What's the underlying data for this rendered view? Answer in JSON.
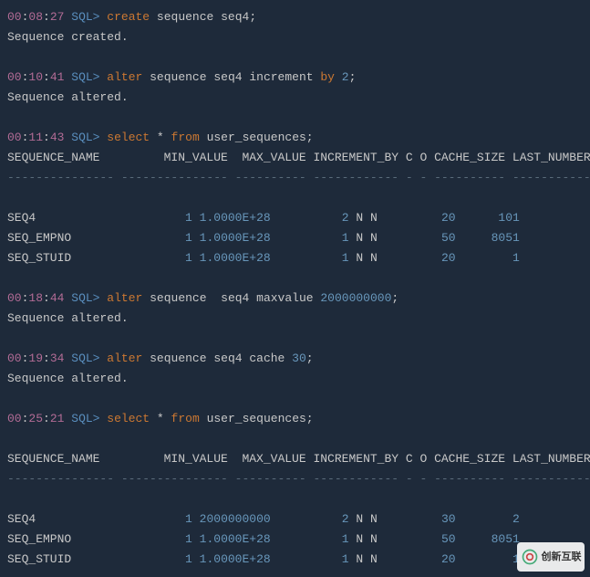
{
  "cmd1": {
    "h": "00",
    "m": "08",
    "s": "27",
    "prompt": "SQL>",
    "k1": "create",
    "id1": "sequence seq4",
    "semi": ";"
  },
  "res1": "Sequence created.",
  "cmd2": {
    "h": "00",
    "m": "10",
    "s": "41",
    "prompt": "SQL>",
    "k1": "alter",
    "id1": "sequence seq4 increment",
    "k2": "by",
    "num": "2",
    "semi": ";"
  },
  "res2": "Sequence altered.",
  "cmd3": {
    "h": "00",
    "m": "11",
    "s": "43",
    "prompt": "SQL>",
    "k1": "select",
    "star": "*",
    "k2": "from",
    "id1": "user_sequences",
    "semi": ";"
  },
  "hdr1": "SEQUENCE_NAME         MIN_VALUE  MAX_VALUE INCREMENT_BY C O CACHE_SIZE LAST_NUMBER",
  "dash1": "--------------- --------------- ---------- ------------ - - ---------- -----------",
  "row1a": {
    "name": "SEQ4           ",
    "min": "         1",
    "max": "1.0000E+28",
    "inc": "         2",
    "c": "N",
    "o": "N",
    "cache": "        20",
    "last": "     101"
  },
  "row1b": {
    "name": "SEQ_EMPNO      ",
    "min": "         1",
    "max": "1.0000E+28",
    "inc": "         1",
    "c": "N",
    "o": "N",
    "cache": "        50",
    "last": "    8051"
  },
  "row1c": {
    "name": "SEQ_STUID      ",
    "min": "         1",
    "max": "1.0000E+28",
    "inc": "         1",
    "c": "N",
    "o": "N",
    "cache": "        20",
    "last": "       1"
  },
  "cmd4": {
    "h": "00",
    "m": "18",
    "s": "44",
    "prompt": "SQL>",
    "k1": "alter",
    "id1": "sequence  seq4 maxvalue",
    "num": "2000000000",
    "semi": ";"
  },
  "res4": "Sequence altered.",
  "cmd5": {
    "h": "00",
    "m": "19",
    "s": "34",
    "prompt": "SQL>",
    "k1": "alter",
    "id1": "sequence seq4 cache",
    "num": "30",
    "semi": ";"
  },
  "res5": "Sequence altered.",
  "cmd6": {
    "h": "00",
    "m": "25",
    "s": "21",
    "prompt": "SQL>",
    "k1": "select",
    "star": "*",
    "k2": "from",
    "id1": "user_sequences",
    "semi": ";"
  },
  "hdr2": "SEQUENCE_NAME         MIN_VALUE  MAX_VALUE INCREMENT_BY C O CACHE_SIZE LAST_NUMBER",
  "dash2": "--------------- --------------- ---------- ------------ - - ---------- -----------",
  "row2a": {
    "name": "SEQ4           ",
    "min": "         1",
    "max": "2000000000",
    "inc": "         2",
    "c": "N",
    "o": "N",
    "cache": "        30",
    "last": "       2"
  },
  "row2b": {
    "name": "SEQ_EMPNO      ",
    "min": "         1",
    "max": "1.0000E+28",
    "inc": "         1",
    "c": "N",
    "o": "N",
    "cache": "        50",
    "last": "    8051"
  },
  "row2c": {
    "name": "SEQ_STUID      ",
    "min": "         1",
    "max": "1.0000E+28",
    "inc": "         1",
    "c": "N",
    "o": "N",
    "cache": "        20",
    "last": "       1"
  },
  "watermark": "创新互联"
}
